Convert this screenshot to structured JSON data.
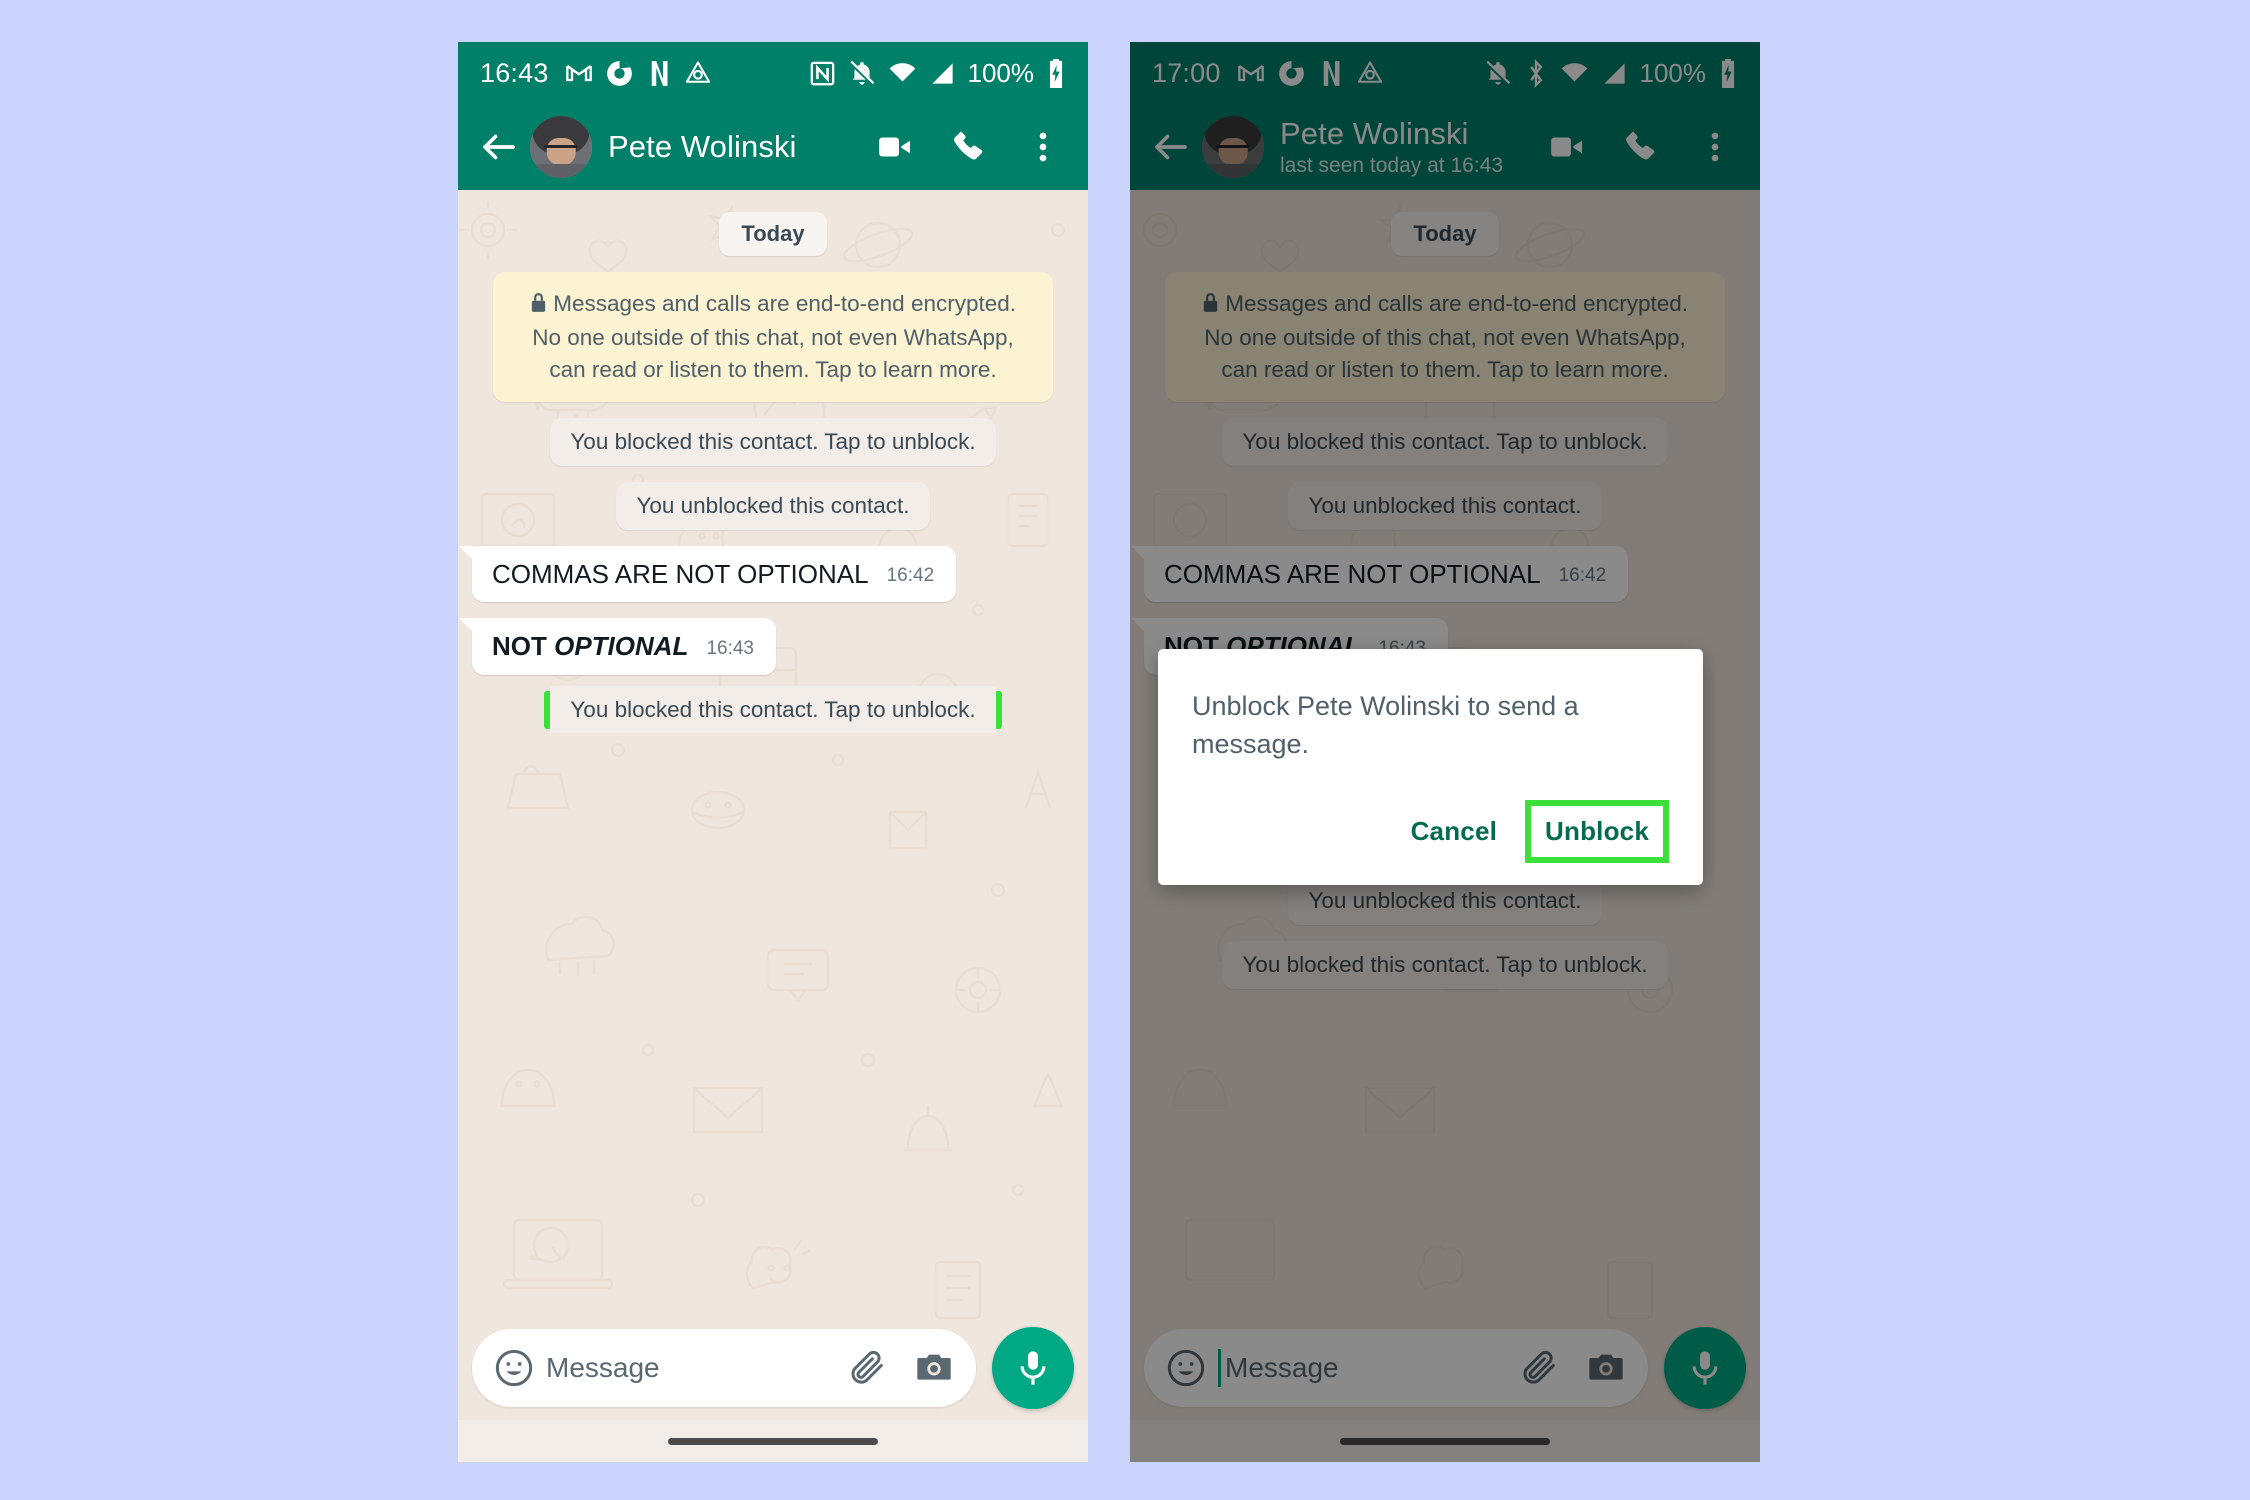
{
  "page": {
    "background_color": "#CBD4FD",
    "highlight_color": "#3BE03B",
    "brand_green": "#008069",
    "accent_green": "#00A884"
  },
  "phones": [
    {
      "id": "left",
      "status_bar": {
        "time": "16:43",
        "left_icons": [
          "gmail-icon",
          "chrome-icon",
          "netflix-icon",
          "google-drive-icon"
        ],
        "right_icons": [
          "nfc-icon",
          "notifications-muted-icon",
          "wifi-icon",
          "cellular-signal-icon"
        ],
        "battery_text": "100%",
        "battery_icon": "battery-charging-icon"
      },
      "header": {
        "back_icon": "back-arrow-icon",
        "avatar": "contact-avatar",
        "title": "Pete Wolinski",
        "subtitle": "",
        "actions": [
          "video-call-icon",
          "voice-call-icon",
          "overflow-menu-icon"
        ]
      },
      "chat": {
        "day_chip": "Today",
        "encryption_notice": "Messages and calls are end-to-end encrypted. No one outside of this chat, not even WhatsApp, can read or listen to them. Tap to learn more.",
        "messages": [
          {
            "kind": "system",
            "text": "You blocked this contact. Tap to unblock.",
            "highlighted": false
          },
          {
            "kind": "system",
            "text": "You unblocked this contact.",
            "highlighted": false
          },
          {
            "kind": "incoming",
            "text": "COMMAS ARE NOT OPTIONAL",
            "time": "16:42",
            "style": "plain"
          },
          {
            "kind": "incoming",
            "text_prefix": "NOT ",
            "text_italic": "OPTIONAL",
            "time": "16:43",
            "style": "bold"
          },
          {
            "kind": "system",
            "text": "You blocked this contact. Tap to unblock.",
            "highlighted": true
          }
        ]
      },
      "input": {
        "emoji_icon": "emoji-smiley-icon",
        "placeholder": "Message",
        "show_caret": false,
        "attach_icon": "paperclip-icon",
        "camera_icon": "camera-icon",
        "mic_icon": "microphone-icon"
      },
      "dialog": null
    },
    {
      "id": "right",
      "status_bar": {
        "time": "17:00",
        "left_icons": [
          "gmail-icon",
          "chrome-icon",
          "netflix-icon",
          "google-drive-icon"
        ],
        "right_icons": [
          "notifications-muted-icon",
          "bluetooth-icon",
          "wifi-icon",
          "cellular-signal-icon"
        ],
        "battery_text": "100%",
        "battery_icon": "battery-charging-icon"
      },
      "header": {
        "back_icon": "back-arrow-icon",
        "avatar": "contact-avatar",
        "title": "Pete Wolinski",
        "subtitle": "last seen today at 16:43",
        "actions": [
          "video-call-icon",
          "voice-call-icon",
          "overflow-menu-icon"
        ]
      },
      "chat": {
        "day_chip": "Today",
        "encryption_notice": "Messages and calls are end-to-end encrypted. No one outside of this chat, not even WhatsApp, can read or listen to them. Tap to learn more.",
        "messages": [
          {
            "kind": "system",
            "text": "You blocked this contact. Tap to unblock.",
            "highlighted": false
          },
          {
            "kind": "system",
            "text": "You unblocked this contact.",
            "highlighted": false
          },
          {
            "kind": "incoming",
            "text": "COMMAS ARE NOT OPTIONAL",
            "time": "16:42",
            "style": "plain"
          },
          {
            "kind": "incoming",
            "text_prefix": "NOT ",
            "text_italic": "OPTIONAL",
            "time": "16:43",
            "style": "bold"
          },
          {
            "kind": "system",
            "text": "You unblocked this contact.",
            "highlighted": false
          },
          {
            "kind": "system",
            "text": "You blocked this contact. Tap to unblock.",
            "highlighted": false
          }
        ]
      },
      "input": {
        "emoji_icon": "emoji-smiley-icon",
        "placeholder": "Message",
        "show_caret": true,
        "attach_icon": "paperclip-icon",
        "camera_icon": "camera-icon",
        "mic_icon": "microphone-icon"
      },
      "dialog": {
        "message": "Unblock Pete Wolinski to send a message.",
        "cancel_label": "Cancel",
        "confirm_label": "Unblock",
        "confirm_highlighted": true
      }
    }
  ]
}
